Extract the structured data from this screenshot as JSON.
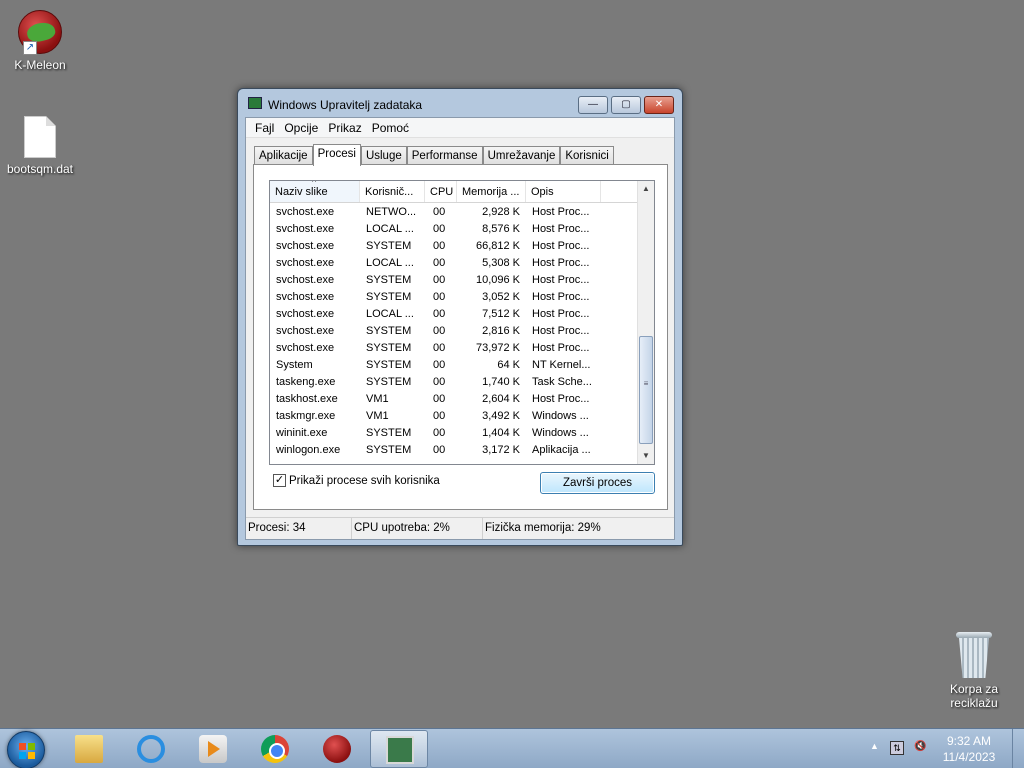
{
  "desktop": {
    "icons": [
      {
        "label": "K-Meleon"
      },
      {
        "label": "bootsqm.dat"
      },
      {
        "label": "Korpa za\nreciklažu"
      }
    ]
  },
  "window": {
    "title": "Windows Upravitelj zadataka",
    "controls": {
      "minimize": "—",
      "maximize": "▢",
      "close": "✕"
    },
    "menu": [
      "Fajl",
      "Opcije",
      "Prikaz",
      "Pomoć"
    ],
    "tabs": [
      "Aplikacije",
      "Procesi",
      "Usluge",
      "Performanse",
      "Umrežavanje",
      "Korisnici"
    ],
    "active_tab": "Procesi",
    "columns": [
      "Naziv slike",
      "Korisnič...",
      "CPU",
      "Memorija ...",
      "Opis"
    ],
    "rows": [
      [
        "svchost.exe",
        "NETWO...",
        "00",
        "2,928 K",
        "Host Proc..."
      ],
      [
        "svchost.exe",
        "LOCAL ...",
        "00",
        "8,576 K",
        "Host Proc..."
      ],
      [
        "svchost.exe",
        "SYSTEM",
        "00",
        "66,812 K",
        "Host Proc..."
      ],
      [
        "svchost.exe",
        "LOCAL ...",
        "00",
        "5,308 K",
        "Host Proc..."
      ],
      [
        "svchost.exe",
        "SYSTEM",
        "00",
        "10,096 K",
        "Host Proc..."
      ],
      [
        "svchost.exe",
        "SYSTEM",
        "00",
        "3,052 K",
        "Host Proc..."
      ],
      [
        "svchost.exe",
        "LOCAL ...",
        "00",
        "7,512 K",
        "Host Proc..."
      ],
      [
        "svchost.exe",
        "SYSTEM",
        "00",
        "2,816 K",
        "Host Proc..."
      ],
      [
        "svchost.exe",
        "SYSTEM",
        "00",
        "73,972 K",
        "Host Proc..."
      ],
      [
        "System",
        "SYSTEM",
        "00",
        "64 K",
        "NT Kernel..."
      ],
      [
        "taskeng.exe",
        "SYSTEM",
        "00",
        "1,740 K",
        "Task Sche..."
      ],
      [
        "taskhost.exe",
        "VM1",
        "00",
        "2,604 K",
        "Host Proc..."
      ],
      [
        "taskmgr.exe",
        "VM1",
        "00",
        "3,492 K",
        "Windows ..."
      ],
      [
        "wininit.exe",
        "SYSTEM",
        "00",
        "1,404 K",
        "Windows ..."
      ],
      [
        "winlogon.exe",
        "SYSTEM",
        "00",
        "3,172 K",
        "Aplikacija ..."
      ]
    ],
    "show_all_checkbox": {
      "label": "Prikaži procese svih korisnika",
      "checked": true,
      "mark": "✓"
    },
    "end_process_button": "Završi proces",
    "status": {
      "processes": "Procesi: 34",
      "cpu": "CPU upotreba: 2%",
      "memory": "Fizička memorija: 29%"
    }
  },
  "taskbar": {
    "pinned": [
      {
        "icon": "windows-explorer-icon"
      },
      {
        "icon": "internet-explorer-icon"
      },
      {
        "icon": "media-player-icon"
      },
      {
        "icon": "chrome-icon"
      },
      {
        "icon": "k-meleon-icon"
      },
      {
        "icon": "task-manager-icon"
      }
    ],
    "tray_arrow": "▲",
    "clock_time": "9:32 AM",
    "clock_date": "11/4/2023"
  }
}
